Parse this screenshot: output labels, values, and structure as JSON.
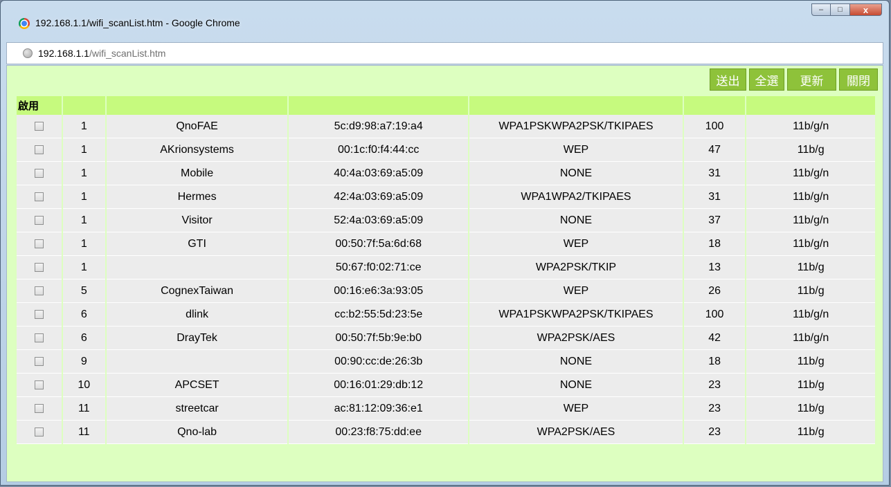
{
  "window": {
    "title": "192.168.1.1/wifi_scanList.htm - Google Chrome",
    "min": "–",
    "max": "□",
    "close": "x"
  },
  "address": {
    "host": "192.168.1.1",
    "path": "/wifi_scanList.htm"
  },
  "toolbar": {
    "send": "送出",
    "select_all": "全選",
    "refresh": "更新",
    "close": "關閉"
  },
  "table": {
    "headers": [
      "啟用",
      "",
      "",
      "",
      "",
      "",
      ""
    ],
    "rows": [
      {
        "ch": "1",
        "ssid": "QnoFAE",
        "mac": "5c:d9:98:a7:19:a4",
        "sec": "WPA1PSKWPA2PSK/TKIPAES",
        "sig": "100",
        "mode": "11b/g/n"
      },
      {
        "ch": "1",
        "ssid": "AKrionsystems",
        "mac": "00:1c:f0:f4:44:cc",
        "sec": "WEP",
        "sig": "47",
        "mode": "11b/g"
      },
      {
        "ch": "1",
        "ssid": "Mobile",
        "mac": "40:4a:03:69:a5:09",
        "sec": "NONE",
        "sig": "31",
        "mode": "11b/g/n"
      },
      {
        "ch": "1",
        "ssid": "Hermes",
        "mac": "42:4a:03:69:a5:09",
        "sec": "WPA1WPA2/TKIPAES",
        "sig": "31",
        "mode": "11b/g/n"
      },
      {
        "ch": "1",
        "ssid": "Visitor",
        "mac": "52:4a:03:69:a5:09",
        "sec": "NONE",
        "sig": "37",
        "mode": "11b/g/n"
      },
      {
        "ch": "1",
        "ssid": "GTI",
        "mac": "00:50:7f:5a:6d:68",
        "sec": "WEP",
        "sig": "18",
        "mode": "11b/g/n"
      },
      {
        "ch": "1",
        "ssid": "",
        "mac": "50:67:f0:02:71:ce",
        "sec": "WPA2PSK/TKIP",
        "sig": "13",
        "mode": "11b/g"
      },
      {
        "ch": "5",
        "ssid": "CognexTaiwan",
        "mac": "00:16:e6:3a:93:05",
        "sec": "WEP",
        "sig": "26",
        "mode": "11b/g"
      },
      {
        "ch": "6",
        "ssid": "dlink",
        "mac": "cc:b2:55:5d:23:5e",
        "sec": "WPA1PSKWPA2PSK/TKIPAES",
        "sig": "100",
        "mode": "11b/g/n"
      },
      {
        "ch": "6",
        "ssid": "DrayTek",
        "mac": "00:50:7f:5b:9e:b0",
        "sec": "WPA2PSK/AES",
        "sig": "42",
        "mode": "11b/g/n"
      },
      {
        "ch": "9",
        "ssid": "",
        "mac": "00:90:cc:de:26:3b",
        "sec": "NONE",
        "sig": "18",
        "mode": "11b/g"
      },
      {
        "ch": "10",
        "ssid": "APCSET",
        "mac": "00:16:01:29:db:12",
        "sec": "NONE",
        "sig": "23",
        "mode": "11b/g"
      },
      {
        "ch": "11",
        "ssid": "streetcar",
        "mac": "ac:81:12:09:36:e1",
        "sec": "WEP",
        "sig": "23",
        "mode": "11b/g"
      },
      {
        "ch": "11",
        "ssid": "Qno-lab",
        "mac": "00:23:f8:75:dd:ee",
        "sec": "WPA2PSK/AES",
        "sig": "23",
        "mode": "11b/g"
      }
    ]
  }
}
